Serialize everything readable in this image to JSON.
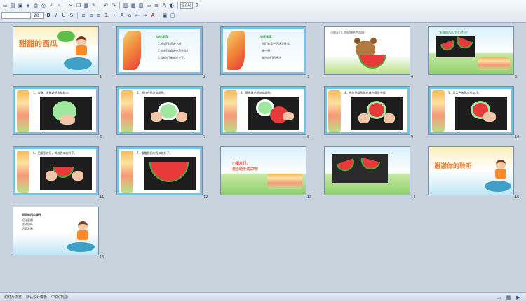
{
  "toolbar": {
    "font_name": "",
    "font_size": "20+",
    "bold": "B",
    "italic": "I",
    "underline": "U",
    "shadow": "S",
    "help": "?"
  },
  "slides": [
    {
      "number": "1",
      "title": "甜甜的西瓜"
    },
    {
      "number": "2",
      "heading": "讲述导语：",
      "lines": [
        "1. 你们认识这个吗？",
        "2. 你们知道这些是什么？",
        "3. 请你们来描述一下。"
      ]
    },
    {
      "number": "3",
      "heading": "讲述导语：",
      "lines": [
        "你们来看一下这是什么",
        "想一想",
        "说出你们的想法"
      ]
    },
    {
      "number": "4",
      "heading": "小朋友们，你们想吃西瓜吗？"
    },
    {
      "number": "5",
      "heading": "\"纸做的西瓜\"你们会吗？"
    },
    {
      "number": "6",
      "step": "1、准备：准备好纸张和胶水。"
    },
    {
      "number": "7",
      "step": "2、将红色纸剪成圆形。"
    },
    {
      "number": "8",
      "step": "3、再将绿色纸剪成圆形。"
    },
    {
      "number": "9",
      "step": "4、将红色圆形贴在绿色圆形中间。"
    },
    {
      "number": "10",
      "step": "5、用黑色笔画出西瓜籽。"
    },
    {
      "number": "11",
      "step": "6、把圆形对折，做成西瓜的样子。"
    },
    {
      "number": "12",
      "step": "7、看看我们的西瓜做好了。"
    },
    {
      "number": "13",
      "heading": "小朋友们，",
      "sub": "自己动手试试吧！"
    },
    {
      "number": "14"
    },
    {
      "number": "15",
      "title": "谢谢你的聆听"
    },
    {
      "number": "16",
      "lines": [
        "甜甜的西瓜课件",
        "设计意图",
        "活动目标",
        "活动准备"
      ]
    }
  ],
  "statusbar": {
    "view": "幻灯片浏览",
    "theme": "默认设计模板",
    "language": "中文(中国)",
    "zoom": "50%"
  }
}
